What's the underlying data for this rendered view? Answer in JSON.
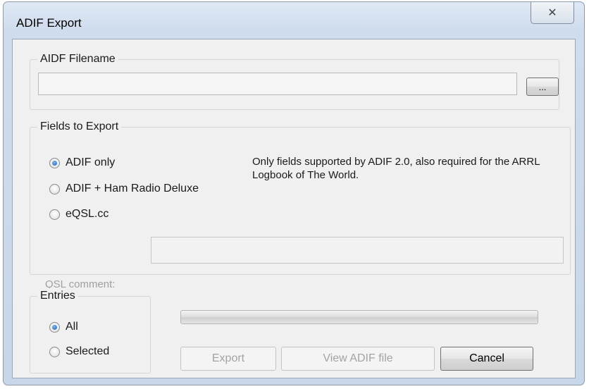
{
  "window": {
    "title": "ADIF Export",
    "close_glyph": "✕"
  },
  "filename_group": {
    "label": "AIDF Filename",
    "value": "",
    "browse_label": "..."
  },
  "fields_group": {
    "label": "Fields to Export",
    "options": [
      {
        "label": "ADIF only",
        "checked": true
      },
      {
        "label": "ADIF + Ham Radio Deluxe",
        "checked": false
      },
      {
        "label": "eQSL.cc",
        "checked": false
      }
    ],
    "description": "Only fields supported by ADIF 2.0, also required for the ARRL Logbook of The World.",
    "qsl_comment_label": "QSL comment:",
    "qsl_comment_value": ""
  },
  "entries_group": {
    "label": "Entries",
    "options": [
      {
        "label": "All",
        "checked": true
      },
      {
        "label": "Selected",
        "checked": false
      }
    ]
  },
  "progress": {
    "percent": 0
  },
  "buttons": {
    "export": "Export",
    "view": "View ADIF file",
    "cancel": "Cancel"
  }
}
